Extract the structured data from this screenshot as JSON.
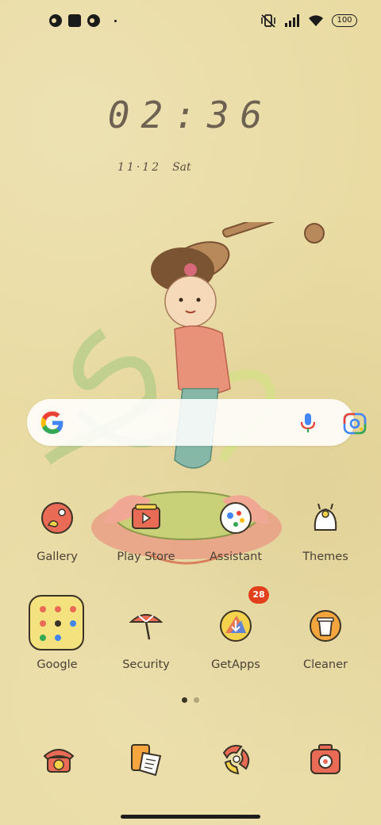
{
  "status_bar": {
    "battery_level": "100",
    "left_icons": [
      "notification-icon",
      "square-icon",
      "notification-icon",
      "dot-icon"
    ],
    "right_icons": [
      "vibrate-off-icon",
      "signal-icon",
      "wifi-icon",
      "battery-icon"
    ]
  },
  "clock": {
    "time": "02:36",
    "date": "11·12",
    "day": "Sat"
  },
  "search": {
    "icons": [
      "google-g-icon",
      "microphone-icon",
      "google-lens-icon"
    ]
  },
  "apps": {
    "row1": [
      {
        "label": "Gallery",
        "icon": "gallery-icon"
      },
      {
        "label": "Play Store",
        "icon": "play-store-icon"
      },
      {
        "label": "Assistant",
        "icon": "assistant-icon"
      },
      {
        "label": "Themes",
        "icon": "themes-icon"
      }
    ],
    "row2": [
      {
        "label": "Google",
        "icon": "google-folder-icon"
      },
      {
        "label": "Security",
        "icon": "security-icon"
      },
      {
        "label": "GetApps",
        "icon": "getapps-icon",
        "badge": "28"
      },
      {
        "label": "Cleaner",
        "icon": "cleaner-icon"
      }
    ]
  },
  "pager": {
    "pages": 2,
    "active": 1
  },
  "dock": [
    "phone-icon",
    "notes-icon",
    "browser-icon",
    "camera-icon"
  ],
  "colors": {
    "background": "#e9dba2",
    "badge": "#e2401c",
    "icon_accent": "#e96a55",
    "folder": "#f4e27e"
  }
}
